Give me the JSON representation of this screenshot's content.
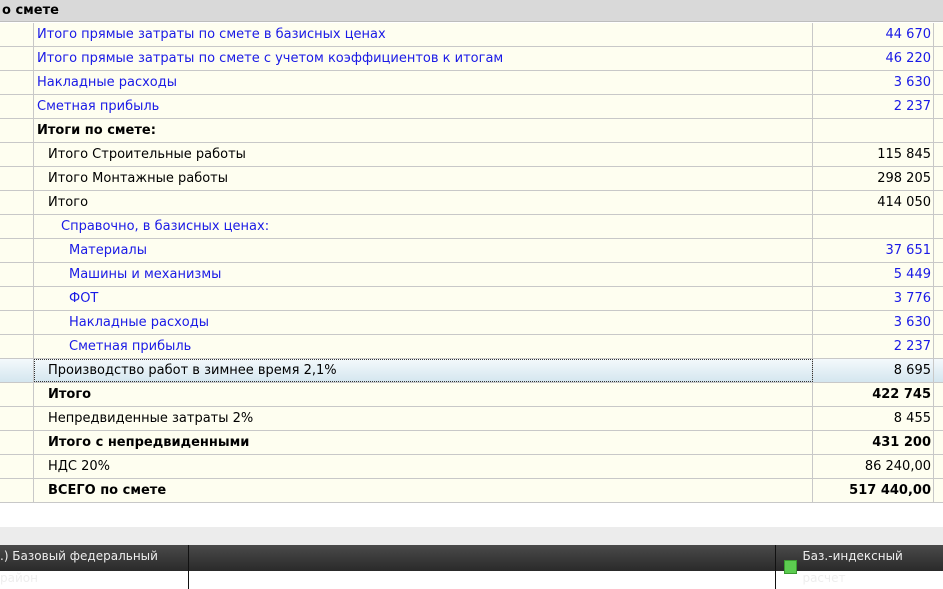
{
  "header": {
    "title": "о смете"
  },
  "rows": [
    {
      "label": "Итого прямые затраты по смете в базисных ценах",
      "value": "44 670",
      "indent": 0,
      "style": "blue"
    },
    {
      "label": "Итого прямые затраты по смете с учетом коэффициентов к итогам",
      "value": "46 220",
      "indent": 0,
      "style": "blue"
    },
    {
      "label": "Накладные расходы",
      "value": "3 630",
      "indent": 0,
      "style": "blue"
    },
    {
      "label": "Сметная прибыль",
      "value": "2 237",
      "indent": 0,
      "style": "blue"
    },
    {
      "label": "Итоги по смете:",
      "value": "",
      "indent": 0,
      "style": "bold"
    },
    {
      "label": "Итого Строительные работы",
      "value": "115 845",
      "indent": 1,
      "style": ""
    },
    {
      "label": "Итого Монтажные работы",
      "value": "298 205",
      "indent": 1,
      "style": ""
    },
    {
      "label": "Итого",
      "value": "414 050",
      "indent": 1,
      "style": ""
    },
    {
      "label": "Справочно, в базисных ценах:",
      "value": "",
      "indent": 2,
      "style": "blue"
    },
    {
      "label": "Материалы",
      "value": "37 651",
      "indent": 3,
      "style": "blue"
    },
    {
      "label": "Машины и механизмы",
      "value": "5 449",
      "indent": 3,
      "style": "blue"
    },
    {
      "label": "ФОТ",
      "value": "3 776",
      "indent": 3,
      "style": "blue"
    },
    {
      "label": "Накладные расходы",
      "value": "3 630",
      "indent": 3,
      "style": "blue"
    },
    {
      "label": "Сметная прибыль",
      "value": "2 237",
      "indent": 3,
      "style": "blue"
    },
    {
      "label": "Производство работ в зимнее время 2,1%",
      "value": "8 695",
      "indent": 1,
      "style": "",
      "selected": true
    },
    {
      "label": "Итого",
      "value": "422 745",
      "indent": 1,
      "style": "bold"
    },
    {
      "label": "Непредвиденные затраты 2%",
      "value": "8 455",
      "indent": 1,
      "style": ""
    },
    {
      "label": "Итого с непредвиденными",
      "value": "431 200",
      "indent": 1,
      "style": "bold"
    },
    {
      "label": "НДС 20%",
      "value": "86 240,00",
      "indent": 1,
      "style": ""
    },
    {
      "label": "ВСЕГО по смете",
      "value": "517 440,00",
      "indent": 1,
      "style": "bold"
    }
  ],
  "status": {
    "region": ".)  Базовый федеральный район",
    "mode": "Баз.-индексный расчет"
  }
}
